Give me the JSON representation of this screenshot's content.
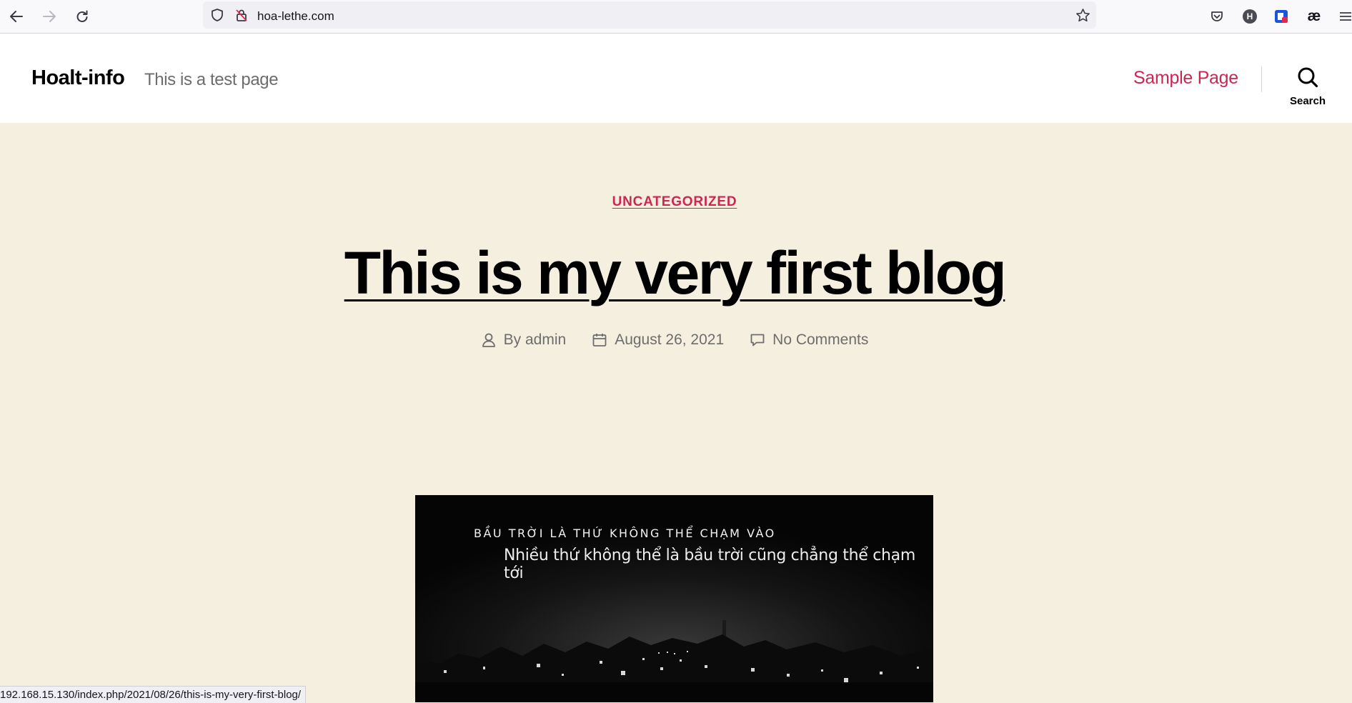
{
  "browser": {
    "url": "hoa-lethe.com",
    "status_url": "192.168.15.130/index.php/2021/08/26/this-is-my-very-first-blog/",
    "extension_h_label": "H",
    "extension_ae_label": "æ"
  },
  "site": {
    "title": "Hoalt-info",
    "description": "This is a test page",
    "menu": [
      {
        "label": "Sample Page"
      }
    ],
    "search_label": "Search"
  },
  "post": {
    "category": "UNCATEGORIZED",
    "title": "This is my very first blog",
    "author": "By admin",
    "date": "August 26, 2021",
    "comments": "No Comments"
  },
  "featured_image": {
    "caption_line1": "BẦU TRỜI LÀ THỨ KHÔNG THỂ CHẠM VÀO",
    "caption_line2": "Nhiều thứ không thể là bầu trời cũng chẳng thể chạm tới"
  },
  "colors": {
    "accent": "#cd2653",
    "background": "#f5efe0",
    "meta_text": "#6d6d6d"
  }
}
